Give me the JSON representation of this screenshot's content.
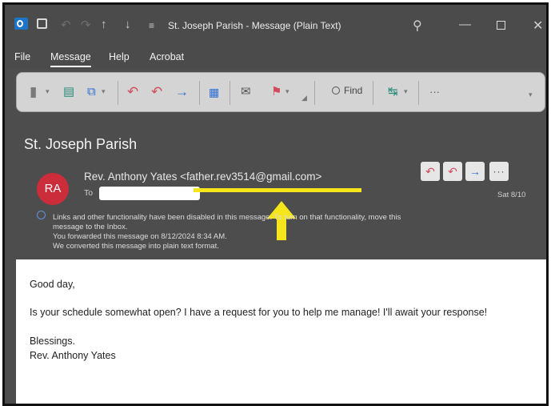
{
  "titlebar": {
    "window_title": "St. Joseph Parish - Message (Plain Text)",
    "icons": [
      "outlook-icon",
      "save-icon",
      "undo-icon",
      "redo-icon",
      "up-arrow-icon",
      "down-arrow-icon",
      "quick-access-icon",
      "search-icon",
      "minimize-icon",
      "maximize-icon",
      "close-icon"
    ]
  },
  "menu": {
    "items": [
      {
        "label": "File"
      },
      {
        "label": "Message"
      },
      {
        "label": "Help"
      },
      {
        "label": "Acrobat"
      }
    ],
    "active": "Message"
  },
  "ribbon": {
    "find_label": "Find",
    "more_label": "···",
    "icons": [
      "delete-icon",
      "archive-icon",
      "move-icon",
      "reply-icon",
      "reply-all-icon",
      "forward-icon",
      "apps-icon",
      "respond-icon",
      "flag-icon",
      "find-icon",
      "translate-icon"
    ]
  },
  "message": {
    "subject": "St. Joseph Parish",
    "avatar_initials": "RA",
    "sender": "Rev. Anthony Yates <father.rev3514@gmail.com>",
    "to_label": "To",
    "date": "Sat 8/10",
    "actions": [
      "reply",
      "reply-all",
      "forward",
      "more"
    ],
    "info_lines": [
      "Links and other functionality have been disabled in this message. To turn on that functionality, move this",
      "message to the Inbox.",
      "You forwarded this message on 8/12/2024 8:34 AM.",
      "We converted this message into plain text format."
    ],
    "body": {
      "greeting": "Good day,",
      "line1": "Is your schedule somewhat open? I have a request for you to help me manage! I'll await your response!",
      "closing": "Blessings.",
      "signature": "Rev. Anthony Yates"
    }
  },
  "colors": {
    "accent_yellow": "#f5e51a",
    "avatar_red": "#cc2d3a",
    "reply_red": "#d24b5d",
    "forward_blue": "#2c6ed6"
  }
}
